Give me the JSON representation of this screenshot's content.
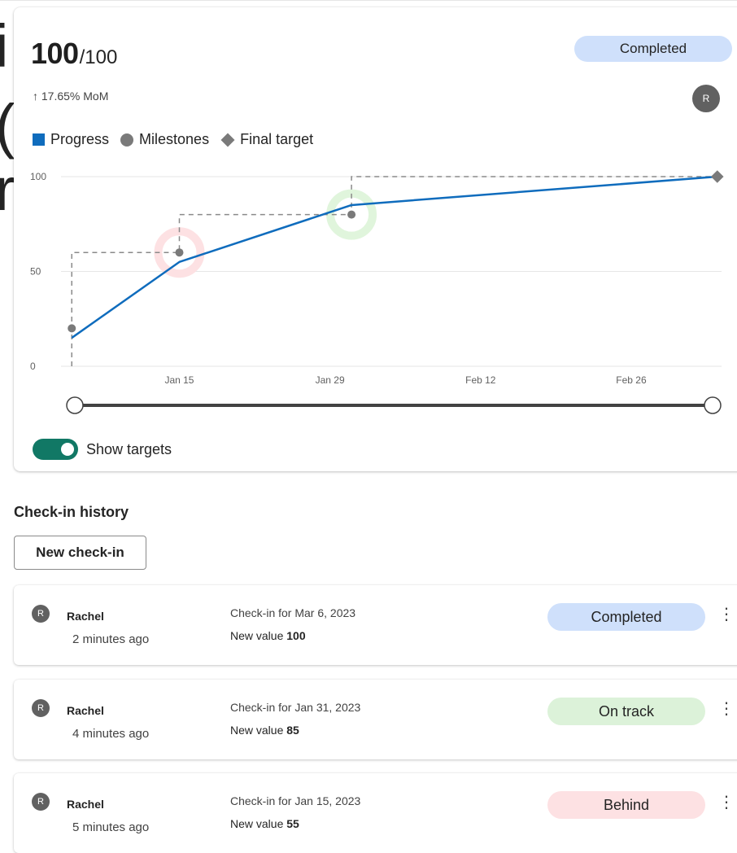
{
  "background": {
    "glyphs": [
      "i",
      "(",
      "r"
    ]
  },
  "summary": {
    "score": "100",
    "total": "/100",
    "status": "Completed",
    "status_color": "#cfe0fb",
    "change": "↑ 17.65% MoM",
    "owner_initial": "R"
  },
  "legend": {
    "progress": "Progress",
    "milestones": "Milestones",
    "final_target": "Final target"
  },
  "chart_data": {
    "type": "line",
    "y_ticks": [
      "100",
      "50",
      "0"
    ],
    "x_ticks": [
      "Jan 15",
      "Jan 29",
      "Feb 12",
      "Feb 26"
    ],
    "ylim": [
      0,
      100
    ],
    "xlim": [
      "2023-01-04",
      "2023-03-07"
    ],
    "series": [
      {
        "name": "Progress",
        "color": "#0f6cbd",
        "points": [
          {
            "x": "2023-01-05",
            "y": 15
          },
          {
            "x": "2023-01-15",
            "y": 55
          },
          {
            "x": "2023-01-31",
            "y": 85
          },
          {
            "x": "2023-03-06",
            "y": 100
          }
        ]
      },
      {
        "name": "Milestones",
        "color": "#7a7a7a",
        "points": [
          {
            "x": "2023-01-05",
            "y": 20
          },
          {
            "x": "2023-01-15",
            "y": 60
          },
          {
            "x": "2023-01-31",
            "y": 80
          }
        ]
      },
      {
        "name": "Final target",
        "color": "#7a7a7a",
        "points": [
          {
            "x": "2023-03-06",
            "y": 100
          }
        ]
      }
    ],
    "highlights": [
      {
        "x": "2023-01-15",
        "y": 60,
        "color": "#fde1e3"
      },
      {
        "x": "2023-01-31",
        "y": 80,
        "color": "#e0f5dc"
      }
    ],
    "range_slider": {
      "start": 0,
      "end": 1
    }
  },
  "toggle": {
    "label": "Show targets",
    "on": true
  },
  "history": {
    "title": "Check-in history",
    "new_button": "New check-in",
    "items": [
      {
        "initial": "R",
        "name": "Rachel",
        "time": "2 minutes ago",
        "for": "Check-in for Mar 6, 2023",
        "value_label": "New value ",
        "value": "100",
        "status": "Completed",
        "status_color": "#cfe0fb",
        "more": "⋮"
      },
      {
        "initial": "R",
        "name": "Rachel",
        "time": "4 minutes ago",
        "for": "Check-in for Jan 31, 2023",
        "value_label": "New value ",
        "value": "85",
        "status": "On track",
        "status_color": "#dcf2d9",
        "more": "⋮"
      },
      {
        "initial": "R",
        "name": "Rachel",
        "time": "5 minutes ago",
        "for": "Check-in for Jan 15, 2023",
        "value_label": "New value ",
        "value": "55",
        "status": "Behind",
        "status_color": "#fde1e3",
        "more": "⋮"
      }
    ]
  }
}
